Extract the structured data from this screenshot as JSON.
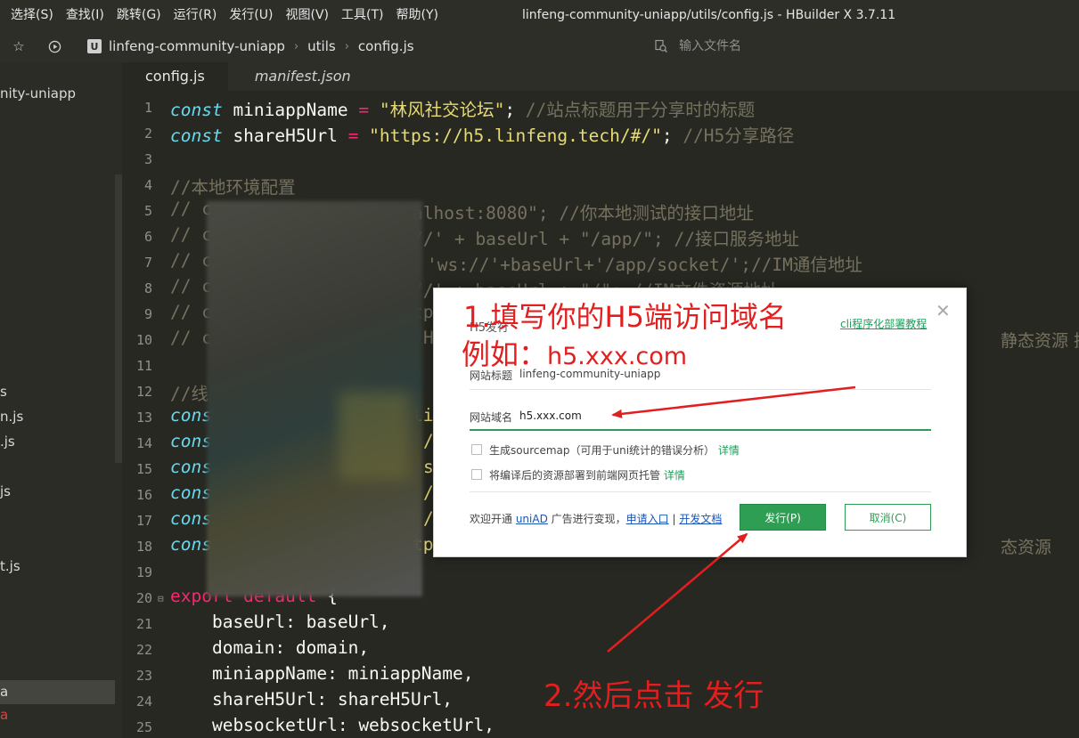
{
  "menu": [
    "选择(S)",
    "查找(I)",
    "跳转(G)",
    "运行(R)",
    "发行(U)",
    "视图(V)",
    "工具(T)",
    "帮助(Y)"
  ],
  "window_title": "linfeng-community-uniapp/utils/config.js - HBuilder X 3.7.11",
  "breadcrumb": {
    "logo": "U",
    "items": [
      "linfeng-community-uniapp",
      "utils",
      "config.js"
    ]
  },
  "file_search": {
    "placeholder": "输入文件名"
  },
  "sidebar": {
    "items": [
      "nity-uniapp",
      "s",
      "n.js",
      ".js",
      "js",
      "t.js",
      "a",
      "a"
    ]
  },
  "tabs": [
    "config.js",
    "manifest.json"
  ],
  "editor": {
    "line_numbers": [
      "1",
      "2",
      "3",
      "4",
      "5",
      "6",
      "7",
      "8",
      "9",
      "10",
      "11",
      "12",
      "13",
      "14",
      "15",
      "16",
      "17",
      "18",
      "19",
      "20",
      "21",
      "22",
      "23",
      "24",
      "25"
    ],
    "line1": {
      "kw": "const",
      "name": " miniappName ",
      "op": "=",
      "str": "\"林风社交论坛\"",
      "semi": ";",
      "cm": " //站点标题用于分享时的标题"
    },
    "line2": {
      "kw": "const",
      "name": " shareH5Url ",
      "op": "=",
      "str": "\"https://h5.linfeng.tech/#/\"",
      "semi": ";",
      "cm": " //H5分享路径"
    },
    "line4": "//本地环境配置",
    "line5": {
      "a": "// c",
      "b": "alhost:8080\"; //你本地测试的接口地址"
    },
    "line6": {
      "a": "// c",
      "b": "//' + baseUrl + \"/app/\"; //接口服务地址"
    },
    "line7": {
      "a": "// c",
      "b": "'ws://'+baseUrl+'/app/socket/';//IM通信地址"
    },
    "line8": {
      "a": "// c",
      "b": "//' + baseUrl + \"/\"; //IM文件资源地址"
    },
    "line9": {
      "a": "// c",
      "b": "tp"
    },
    "line10": {
      "a": "// c",
      "b": "H",
      "c": "静态资源 换"
    },
    "line12": "//线",
    "line13": {
      "a": "cons",
      "b": "li"
    },
    "line14": {
      "a": "cons",
      "b": "/\""
    },
    "line15": {
      "a": "cons",
      "b": "ss"
    },
    "line16": {
      "a": "cons",
      "b": "/\""
    },
    "line17": {
      "a": "cons",
      "b": "/"
    },
    "line18": {
      "a": "cons",
      "b": "tp",
      "c": "态资源"
    },
    "line20": {
      "exp": "export default",
      "rest": " {"
    },
    "line21": "    baseUrl: baseUrl,",
    "line22": "    domain: domain,",
    "line23": "    miniappName: miniappName,",
    "line24": "    shareH5Url: shareH5Url,",
    "line25": "    websocketUrl: websocketUrl,"
  },
  "dialog": {
    "title": "H5发行",
    "top_link": "cli程序化部署教程",
    "site_title_label": "网站标题",
    "site_title_value": "linfeng-community-uniapp",
    "domain_label": "网站域名",
    "domain_value": "h5.xxx.com",
    "sourcemap_prefix": "生成sourcemap（可用于uni统计的错误分析）",
    "sourcemap_link": "详情",
    "deploy_prefix": "将编译后的资源部署到前端网页托管",
    "deploy_link": "详情",
    "footer_prefix": "欢迎开通 ",
    "footer_uniad": "uniAD",
    "footer_mid": " 广告进行变现，",
    "footer_apply": "申请入口",
    "footer_sep": " | ",
    "footer_docs": "开发文档",
    "publish_button": "发行(P)",
    "cancel_button": "取消(C)"
  },
  "annotations": {
    "step1_line1": "1.填写你的H5端访问域名",
    "step1_line2_prefix": "例如：",
    "step1_line2_value": "h5.xxx.com",
    "step2": "2.然后点击   发行",
    "color": "#e21e1e"
  },
  "colors": {
    "editor_bg": "#272822",
    "keyword": "#66d9ef",
    "operator": "#f92672",
    "string": "#e6db74",
    "comment": "#75715e",
    "accent_green": "#2f9e55"
  }
}
